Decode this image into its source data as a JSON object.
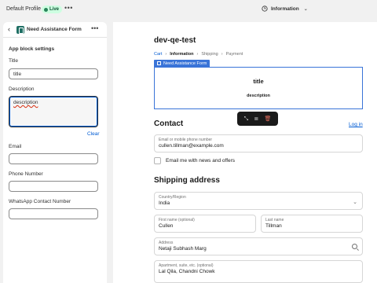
{
  "topbar": {
    "profile_name": "Default Profile",
    "live_badge": "Live",
    "more_icon": "more-horizontal-icon",
    "template_select": "Information"
  },
  "sidebar": {
    "header_title": "Need Assistance Form",
    "section_title": "App block settings",
    "fields": {
      "title_label": "Title",
      "title_value": "title",
      "description_label": "Description",
      "description_value": "description",
      "clear_label": "Clear",
      "email_label": "Email",
      "email_value": "",
      "phone_label": "Phone Number",
      "phone_value": "",
      "whatsapp_label": "WhatsApp Contact Number",
      "whatsapp_value": ""
    }
  },
  "preview": {
    "store_title": "dev-qe-test",
    "breadcrumb": [
      "Cart",
      "Information",
      "Shipping",
      "Payment"
    ],
    "block_tag": "Need Assistance Form",
    "block_title": "title",
    "block_description": "description",
    "contact_heading": "Contact",
    "login_link": "Log in",
    "email_field": {
      "label": "Email or mobile phone number",
      "value": "cullen.tillman@example.com"
    },
    "newsletter_label": "Email me with news and offers",
    "shipping_heading": "Shipping address",
    "country_field": {
      "label": "Country/Region",
      "value": "India"
    },
    "first_name_field": {
      "label": "First name (optional)",
      "value": "Cullen"
    },
    "last_name_field": {
      "label": "Last name",
      "value": "Tillman"
    },
    "address_field": {
      "label": "Address",
      "value": "Netaji Subhash Marg"
    },
    "apartment_field": {
      "label": "Apartment, suite, etc. (optional)",
      "value": "Lal Qila, Chandni Chowk"
    }
  },
  "colors": {
    "accent": "#005bd3",
    "live_badge_bg": "#cdfee1",
    "block_highlight": "#3a74d8",
    "toolbar_bg": "#1a1a1a",
    "delete_icon": "#e06c5c"
  }
}
